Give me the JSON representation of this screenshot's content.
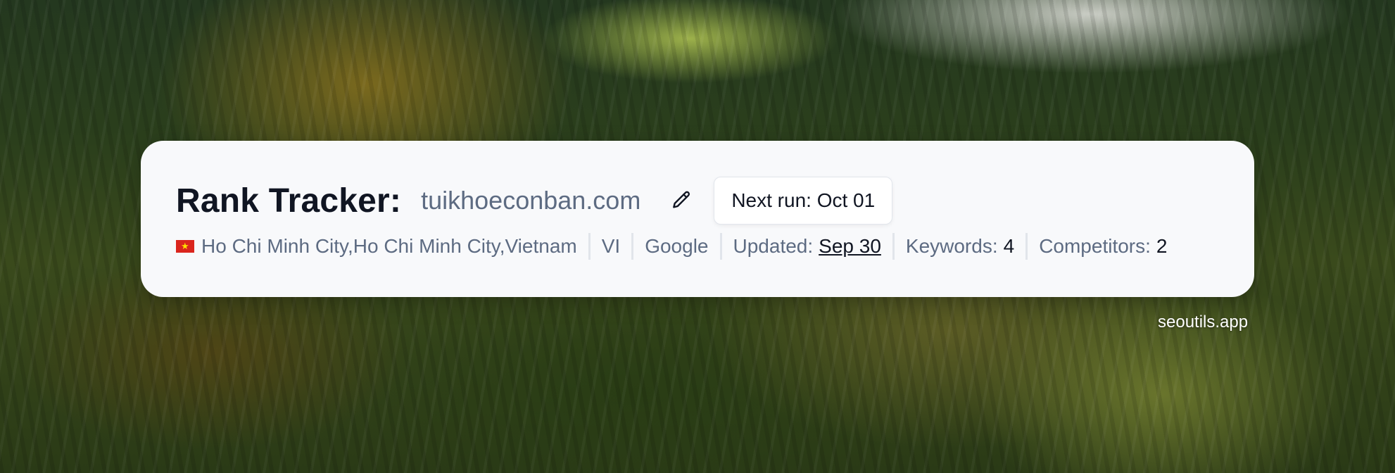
{
  "header": {
    "title": "Rank Tracker:",
    "domain": "tuikhoeconban.com",
    "next_run": "Next run: Oct 01"
  },
  "meta": {
    "flag_icon": "vietnam-flag-icon",
    "location": "Ho Chi Minh City,Ho Chi Minh City,Vietnam",
    "language": "VI",
    "search_engine": "Google",
    "updated_label": "Updated:",
    "updated_value": "Sep 30",
    "keywords_label": "Keywords:",
    "keywords_value": "4",
    "competitors_label": "Competitors:",
    "competitors_value": "2"
  },
  "footer": {
    "brand": "seoutils.app"
  },
  "icons": {
    "edit": "pencil-icon"
  },
  "colors": {
    "title": "#101522",
    "muted": "#5d6b82",
    "card_bg": "#f8f9fb",
    "flag_red": "#da251d",
    "flag_star": "#ffde00"
  }
}
